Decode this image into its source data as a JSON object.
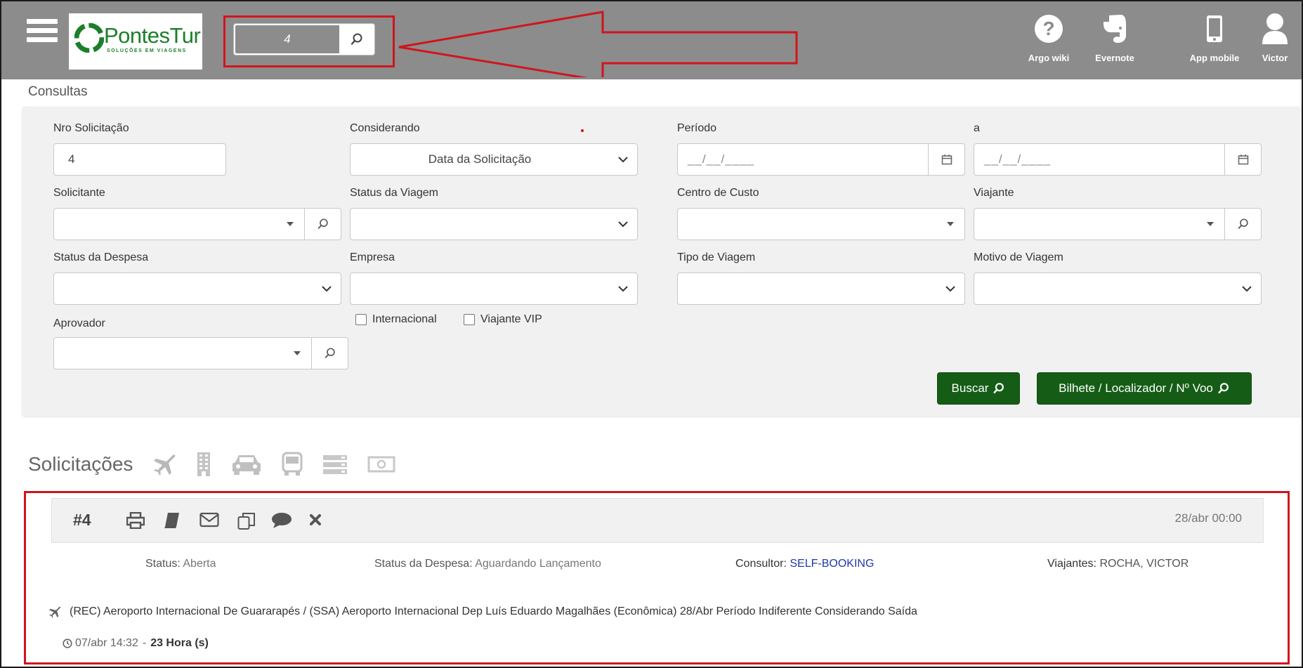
{
  "header": {
    "logo": {
      "name": "PontesTur",
      "tagline": "SOLUÇÕES EM VIAGENS"
    },
    "quick_search": {
      "value": "4"
    },
    "colors": {
      "bar": "#8c8c8c",
      "brand_green": "#1b7f2a",
      "annotation_red": "#d0151c"
    },
    "top_icons": [
      {
        "icon": "help-icon",
        "label": "Argo wiki"
      },
      {
        "icon": "evernote-icon",
        "label": "Evernote"
      },
      {
        "icon": "mobile-icon",
        "label": "App mobile"
      },
      {
        "icon": "user-icon",
        "label": "Victor"
      }
    ]
  },
  "consultas": {
    "title": "Consultas",
    "fields": {
      "nro_solicitacao": {
        "label": "Nro Solicitação",
        "value": "4"
      },
      "considerando": {
        "label": "Considerando",
        "value": "Data da Solicitação"
      },
      "periodo": {
        "label": "Período",
        "value": "__/__/____"
      },
      "periodo_ate": {
        "label": "a",
        "value": "__/__/____"
      },
      "solicitante": {
        "label": "Solicitante",
        "value": ""
      },
      "status_viagem": {
        "label": "Status da Viagem",
        "value": ""
      },
      "centro_custo": {
        "label": "Centro de Custo",
        "value": ""
      },
      "viajante": {
        "label": "Viajante",
        "value": ""
      },
      "status_despesa": {
        "label": "Status da Despesa",
        "value": ""
      },
      "empresa": {
        "label": "Empresa",
        "value": ""
      },
      "tipo_viagem": {
        "label": "Tipo de Viagem",
        "value": ""
      },
      "motivo_viagem": {
        "label": "Motivo de Viagem",
        "value": ""
      },
      "aprovador": {
        "label": "Aprovador",
        "value": ""
      }
    },
    "checkboxes": {
      "internacional": "Internacional",
      "viajante_vip": "Viajante VIP"
    },
    "buttons": {
      "buscar": "Buscar",
      "bilhete": "Bilhete / Localizador / Nº Voo"
    }
  },
  "solicitacoes": {
    "title": "Solicitações",
    "filter_icons": [
      "plane-icon",
      "hotel-icon",
      "car-icon",
      "bus-icon",
      "list-icon",
      "money-icon"
    ],
    "request": {
      "number": "#4",
      "date": "28/abr 00:00",
      "actions": [
        "print-icon",
        "book-icon",
        "envelope-icon",
        "copy-icon",
        "comment-icon",
        "close-icon"
      ],
      "status_label": "Status:",
      "status_value": "Aberta",
      "despesa_label": "Status da Despesa:",
      "despesa_value": "Aguardando Lançamento",
      "consultor_label": "Consultor:",
      "consultor_value": "SELF-BOOKING",
      "viajantes_label": "Viajantes:",
      "viajantes_value": "ROCHA, VICTOR",
      "route": "(REC) Aeroporto Internacional De Guararapés / (SSA) Aeroporto Internacional Dep Luís Eduardo Magalhães (Econômica) 28/Abr Período Indiferente Considerando Saída",
      "time_created": "07/abr 14:32",
      "time_separator": "-",
      "duration": "23 Hora (s)"
    }
  }
}
